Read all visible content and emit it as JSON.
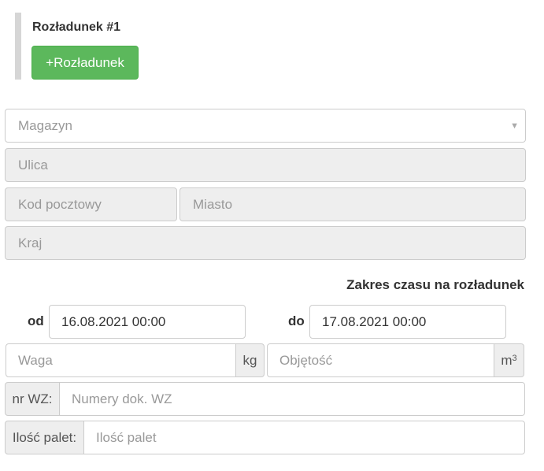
{
  "section": {
    "title": "Rozładunek #1",
    "add_button_label": "+Rozładunek"
  },
  "address": {
    "magazyn_placeholder": "Magazyn",
    "ulica_placeholder": "Ulica",
    "kod_placeholder": "Kod pocztowy",
    "miasto_placeholder": "Miasto",
    "kraj_placeholder": "Kraj"
  },
  "time_range": {
    "title": "Zakres czasu na rozładunek",
    "from_label": "od",
    "from_value": "16.08.2021 00:00",
    "to_label": "do",
    "to_value": "17.08.2021 00:00"
  },
  "cargo": {
    "weight_placeholder": "Waga",
    "weight_unit": "kg",
    "volume_placeholder": "Objętość",
    "volume_unit": "m",
    "volume_unit_exp": "3"
  },
  "documents": {
    "wz_label": "nr WZ:",
    "wz_placeholder": "Numery dok. WZ"
  },
  "pallets": {
    "label": "Ilość palet:",
    "placeholder": "Ilość palet"
  },
  "colors": {
    "button_green": "#5cb85c",
    "disabled_gray": "#eeeeee",
    "border": "#cccccc"
  }
}
